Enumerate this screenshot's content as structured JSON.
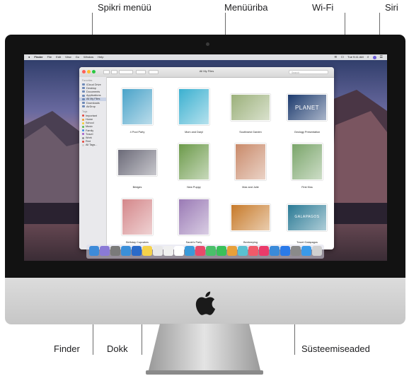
{
  "callouts": {
    "spotlight": "Spikri menüü",
    "menubar": "Menüüriba",
    "wifi": "Wi-Fi",
    "siri": "Siri",
    "finder": "Finder",
    "dock": "Dokk",
    "system_prefs": "Süsteemiseaded"
  },
  "menubar": {
    "apple": "",
    "items": [
      "Finder",
      "File",
      "Edit",
      "View",
      "Go",
      "Window",
      "Help"
    ],
    "clock": "Tue 9:41 AM"
  },
  "window": {
    "title": "All My Files",
    "search_placeholder": "Search",
    "sidebar": {
      "favorites_head": "Favorites",
      "favorites": [
        "iCloud Drive",
        "Desktop",
        "Documents",
        "Applications",
        "All My Files",
        "Downloads",
        "AirDrop"
      ],
      "tags_head": "Tags",
      "tags": [
        {
          "label": "Important",
          "color": "#e2453c"
        },
        {
          "label": "Home",
          "color": "#f39a2b"
        },
        {
          "label": "School",
          "color": "#f5cf33"
        },
        {
          "label": "Music",
          "color": "#5ab94d"
        },
        {
          "label": "Family",
          "color": "#3a8be0"
        },
        {
          "label": "Travel",
          "color": "#a35bc9"
        },
        {
          "label": "Work",
          "color": "#8e8e93"
        },
        {
          "label": "Red",
          "color": "#e2453c"
        },
        {
          "label": "All Tags...",
          "color": "#cccccc"
        }
      ]
    },
    "files": [
      {
        "caption": "4 Pool Party",
        "color": "#4aa3c9"
      },
      {
        "caption": "Mom and Daryl",
        "color": "#3bb0d0"
      },
      {
        "caption": "Southwest Garden",
        "color": "#9bb07a"
      },
      {
        "caption": "Geology Presentation",
        "color": "#1c3a6e",
        "art": "PLANET"
      },
      {
        "caption": "Bridges",
        "color": "#6b6a78"
      },
      {
        "caption": "New Puppy",
        "color": "#6c9a4a"
      },
      {
        "caption": "Max and Julie",
        "color": "#c98a6a"
      },
      {
        "caption": "First Kiss",
        "color": "#7aa56a"
      },
      {
        "caption": "Birthday Cupcakes",
        "color": "#d4878a"
      },
      {
        "caption": "Sarah's Party",
        "color": "#9a7ab5"
      },
      {
        "caption": "Beekeeping",
        "color": "#c77a2a"
      },
      {
        "caption": "Travel Galapagos",
        "color": "#2a7a95",
        "art": "GALAPAGOS"
      }
    ]
  },
  "dock_colors": [
    "#3d8bd9",
    "#8a7ad6",
    "#7a7a7a",
    "#3a8fd9",
    "#2a6ac9",
    "#f5d24a",
    "#e8e8e8",
    "#f0f0f0",
    "#ffffff",
    "#3a9ad9",
    "#e84a6a",
    "#4ac06a",
    "#3ac05a",
    "#e8a03a",
    "#5ac0d0",
    "#f05a6a",
    "#ea3a6a",
    "#3a8ad9",
    "#2a7ae9",
    "#8a8a8a",
    "#3a9ae9",
    "#d0d0d0"
  ]
}
